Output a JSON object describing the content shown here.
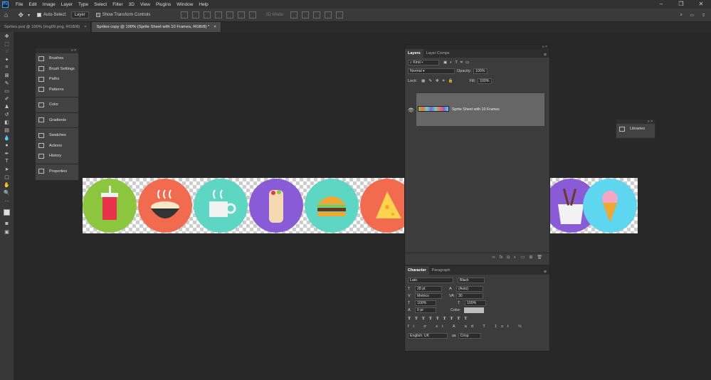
{
  "menubar": {
    "logo": "Ps",
    "items": [
      "File",
      "Edit",
      "Image",
      "Layer",
      "Type",
      "Select",
      "Filter",
      "3D",
      "View",
      "Plugins",
      "Window",
      "Help"
    ]
  },
  "options": {
    "auto_select_label": "Auto-Select:",
    "auto_select_value": "Layer",
    "show_transform": "Show Transform Controls",
    "mode_3d": "3D Mode:"
  },
  "tabs": [
    {
      "label": "Sprites.psd @ 100% (img09.png, RGB/8)"
    },
    {
      "label": "Sprites copy @ 100% (Sprite Sheet with 10 Frames, RGB/8) *"
    }
  ],
  "collapsed_panel": {
    "items": [
      "Brushes",
      "Brush Settings",
      "Paths",
      "Patterns",
      "Color",
      "Gradients",
      "Swatches",
      "Actions",
      "History",
      "Properties"
    ]
  },
  "layers_panel": {
    "tabs": [
      "Layers",
      "Layer Comps"
    ],
    "kind": "Kind",
    "blend": "Normal",
    "opacity_label": "Opacity:",
    "opacity": "100%",
    "lock_label": "Lock:",
    "fill_label": "Fill:",
    "fill": "100%",
    "layer_name": "Sprite Sheet with 10 Frames"
  },
  "character_panel": {
    "tabs": [
      "Character",
      "Paragraph"
    ],
    "font_family": "Lato",
    "font_style": "Black",
    "size": "28 pt",
    "leading": "(Auto)",
    "kerning": "Metrics",
    "tracking": "30",
    "vscale": "100%",
    "hscale": "100%",
    "baseline": "0 pt",
    "color_label": "Color:",
    "language": "English: UK",
    "antialias": "Crisp"
  },
  "libraries": {
    "label": "Libraries"
  },
  "colors": {
    "sprite_bg": [
      "#8cc63f",
      "#f26b4f",
      "#5ed6c4",
      "#8a5bd6",
      "#5ed6c4",
      "#f26b4f",
      "#8a5bd6",
      "#5ed6f0"
    ]
  }
}
